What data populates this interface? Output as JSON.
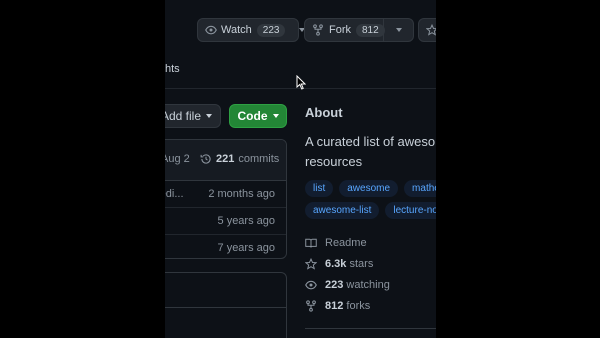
{
  "header": {
    "watch_label": "Watch",
    "watch_count": "223",
    "fork_label": "Fork",
    "fork_count": "812",
    "tab_fragment": "hts"
  },
  "toolbar": {
    "add_file_label": "Add file",
    "code_label": "Code"
  },
  "files": {
    "last_commit_date": "Aug 2",
    "commit_count": "221",
    "commit_label": "commits",
    "rows": [
      {
        "name": "redi...",
        "age": "2 months ago"
      },
      {
        "name": "",
        "age": "5 years ago"
      },
      {
        "name": "",
        "age": "7 years ago"
      }
    ]
  },
  "about": {
    "title": "About",
    "description": "A curated list of awesome resources",
    "topics": [
      "list",
      "awesome",
      "mathen",
      "awesome-list",
      "lecture-not"
    ],
    "readme_label": "Readme",
    "stars_value": "6.3k",
    "stars_label": "stars",
    "watching_value": "223",
    "watching_label": "watching",
    "forks_value": "812",
    "forks_label": "forks"
  },
  "colors": {
    "background": "#0d1117",
    "accent_green": "#238636",
    "topic_blue": "#58a6ff"
  },
  "icons": [
    "eye-icon",
    "fork-icon",
    "history-icon",
    "book-icon",
    "star-icon",
    "cursor-icon"
  ]
}
